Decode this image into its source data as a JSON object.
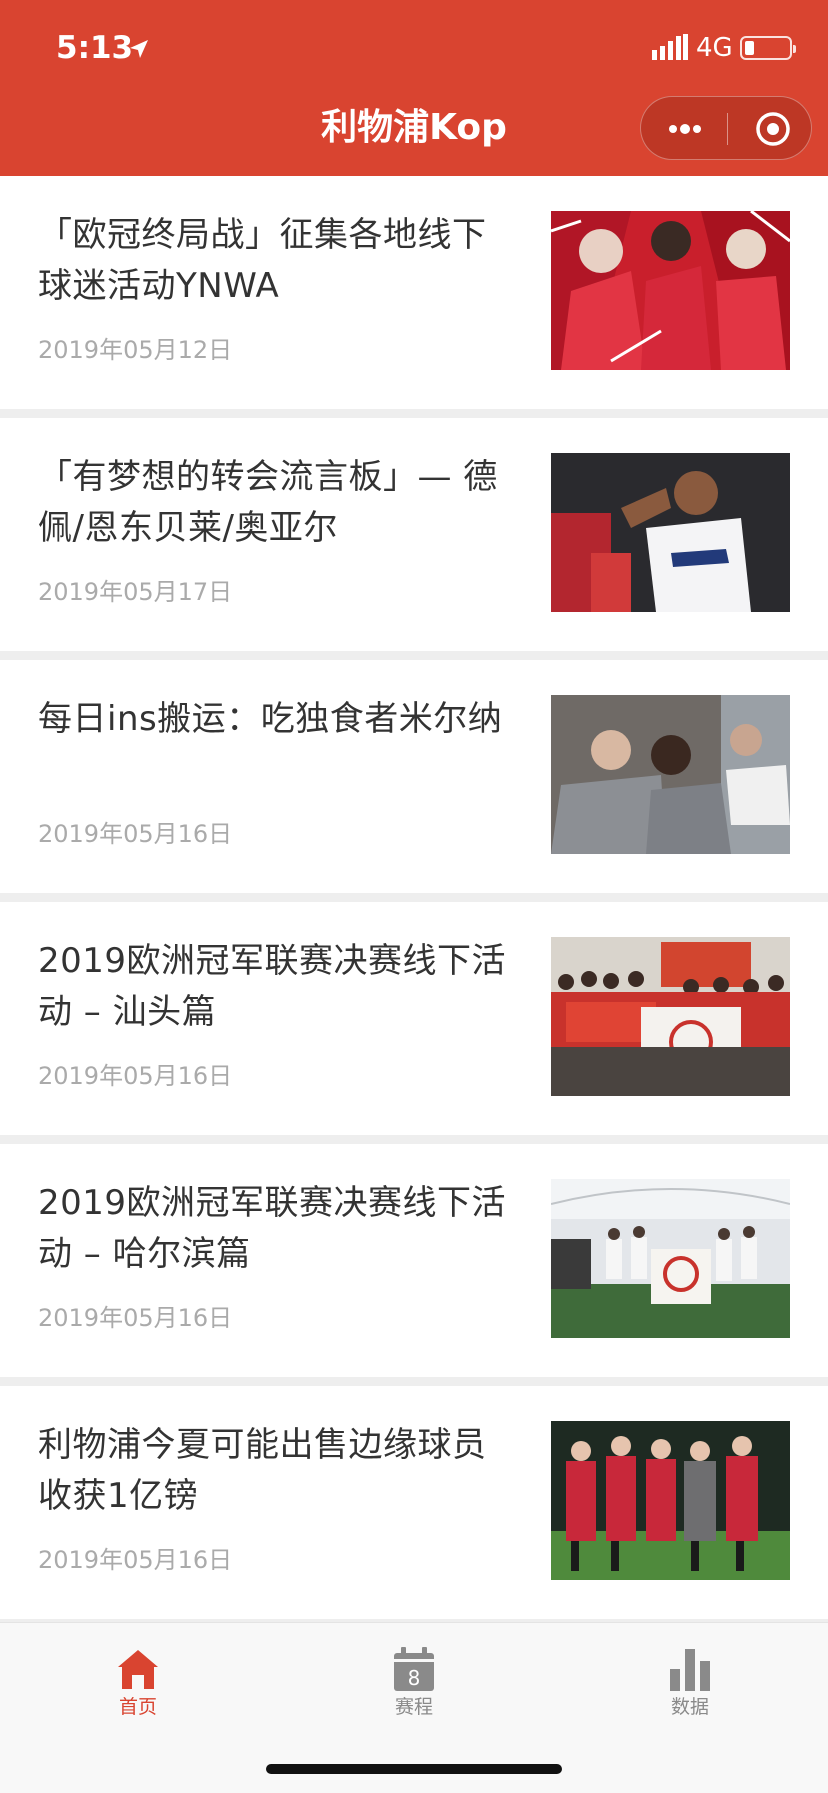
{
  "status_bar": {
    "time": "5:13",
    "network": "4G"
  },
  "nav": {
    "title": "利物浦Kop"
  },
  "articles": [
    {
      "title": "「欧冠终局战」征集各地线下球迷活动YNWA",
      "date": "2019年05月12日"
    },
    {
      "title": "「有梦想的转会流言板」— 德佩/恩东贝莱/奥亚尔",
      "date": "2019年05月17日"
    },
    {
      "title": "每日ins搬运：吃独食者米尔纳",
      "date": "2019年05月16日"
    },
    {
      "title": "2019欧洲冠军联赛决赛线下活动 – 汕头篇",
      "date": "2019年05月16日"
    },
    {
      "title": "2019欧洲冠军联赛决赛线下活动 – 哈尔滨篇",
      "date": "2019年05月16日"
    },
    {
      "title": "利物浦今夏可能出售边缘球员收获1亿镑",
      "date": "2019年05月16日"
    }
  ],
  "tabbar": {
    "tabs": [
      {
        "label": "首页",
        "icon": "home-icon",
        "active": true
      },
      {
        "label": "赛程",
        "icon": "calendar-icon",
        "badge": "8",
        "active": false
      },
      {
        "label": "数据",
        "icon": "bar-chart-icon",
        "active": false
      }
    ]
  },
  "colors": {
    "accent": "#d94430",
    "text_primary": "#333333",
    "text_secondary": "#aaaaaa",
    "tab_inactive": "#8a8a8a",
    "divider": "#eeeeee"
  }
}
